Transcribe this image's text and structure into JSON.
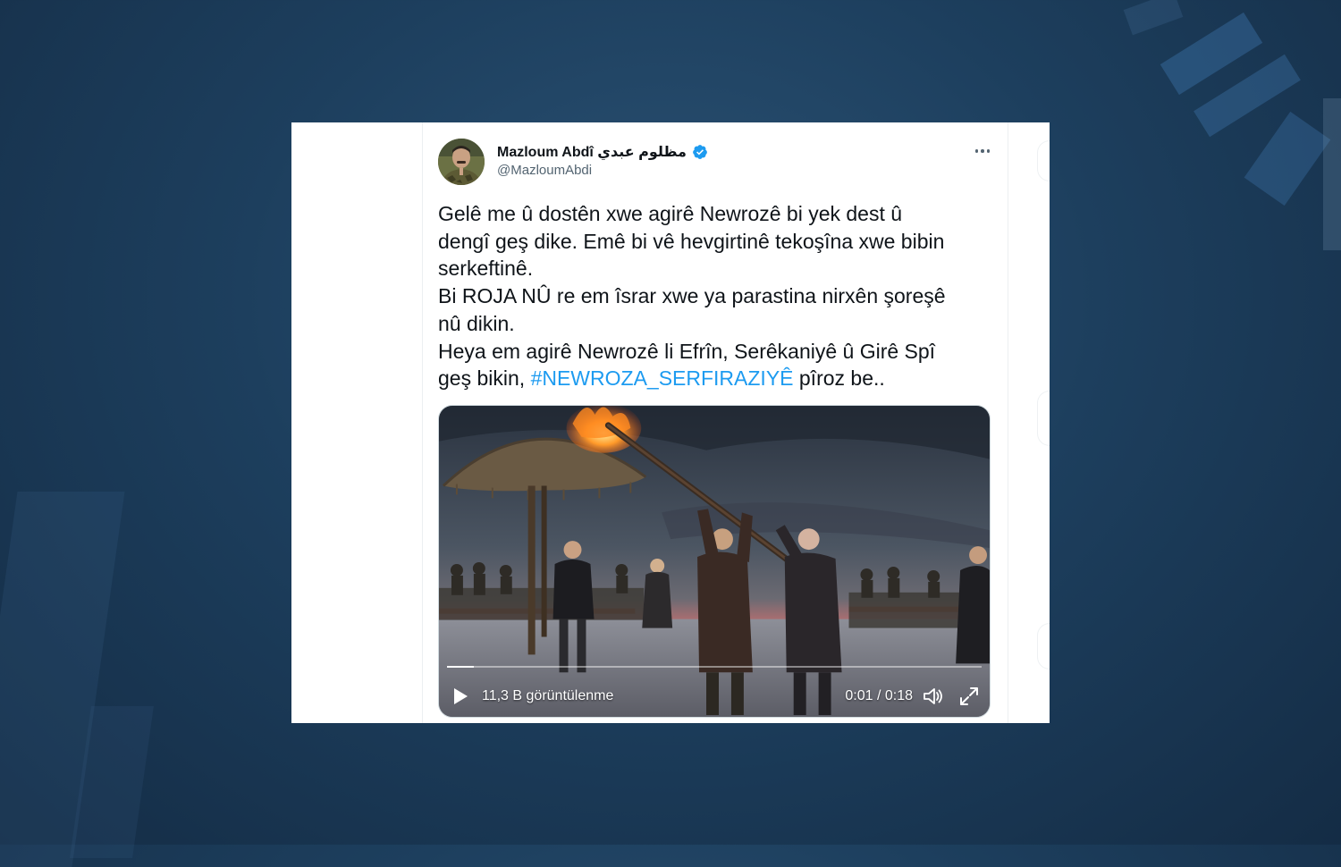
{
  "tweet": {
    "display_name": "Mazloum Abdî مظلوم عبدي",
    "handle": "@MazloumAbdi",
    "verified": true,
    "text_lines": [
      "Gelê me û dostên xwe agirê Newrozê bi yek dest û",
      "dengî geş dike. Emê bi vê hevgirtinê tekoşîna xwe bibin",
      "serkeftinê.",
      "Bi ROJA NÛ re em îsrar xwe ya parastina nirxên şoreşê",
      "nû dikin.",
      "Heya em agirê Newrozê li Efrîn, Serêkaniyê û Girê Spî"
    ],
    "last_line_before": "geş bikin, ",
    "hashtag": "#NEWROZA_SERFIRAZIYÊ",
    "last_line_after": " pîroz be..",
    "link_color": "#1d9bf0"
  },
  "video": {
    "views": "11,3 B görüntülenme",
    "time": "0:01 / 0:18",
    "progress": 0.05
  },
  "icons": {
    "more": "more-icon",
    "verified": "verified-badge-icon",
    "play": "play-icon",
    "volume": "volume-icon",
    "fullscreen": "fullscreen-icon"
  }
}
